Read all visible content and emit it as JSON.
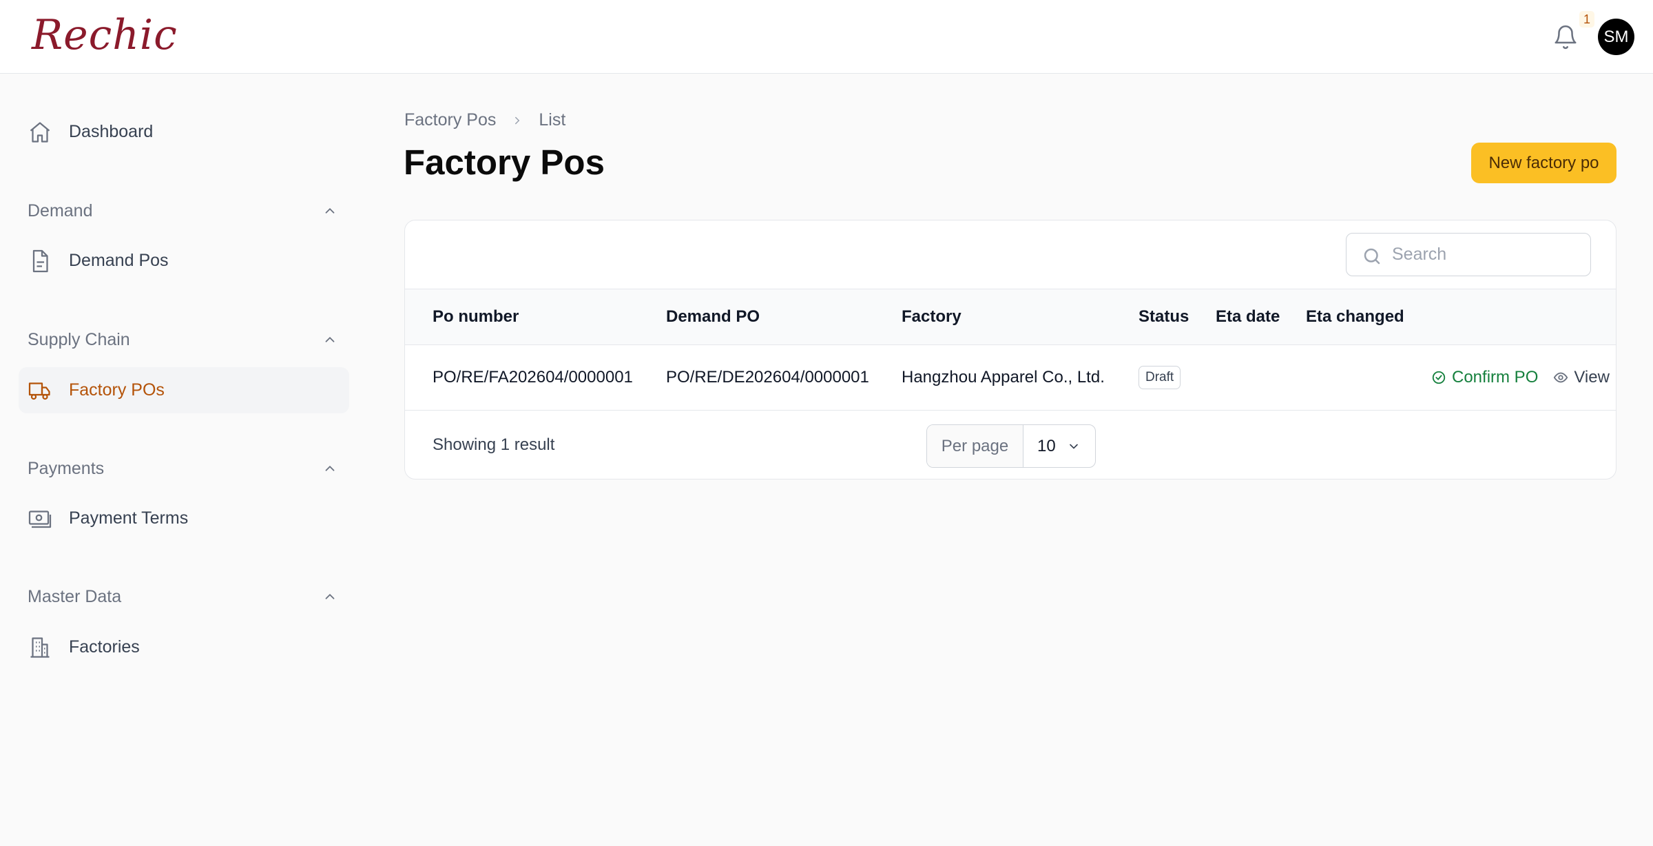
{
  "brand": {
    "logo_text": "Rechic",
    "color": "#8b1a2b"
  },
  "header": {
    "notification_count": "1",
    "user_initials": "SM"
  },
  "sidebar": {
    "dashboard": "Dashboard",
    "groups": [
      {
        "title": "Demand",
        "items": [
          "Demand Pos"
        ]
      },
      {
        "title": "Supply Chain",
        "items": [
          "Factory POs"
        ]
      },
      {
        "title": "Payments",
        "items": [
          "Payment Terms"
        ]
      },
      {
        "title": "Master Data",
        "items": [
          "Factories"
        ]
      }
    ],
    "active_item": "Factory POs"
  },
  "breadcrumb": {
    "parent": "Factory Pos",
    "current": "List"
  },
  "page": {
    "title": "Factory Pos",
    "new_button": "New factory po"
  },
  "search": {
    "placeholder": "Search"
  },
  "table": {
    "columns": [
      "Po number",
      "Demand PO",
      "Factory",
      "Status",
      "Eta date",
      "Eta changed"
    ],
    "rows": [
      {
        "po_number": "PO/RE/FA202604/0000001",
        "demand_po": "PO/RE/DE202604/0000001",
        "factory": "Hangzhou Apparel Co., Ltd.",
        "status": "Draft",
        "eta_date": "",
        "eta_changed": "",
        "actions": [
          "Confirm PO",
          "View"
        ]
      }
    ]
  },
  "pagination": {
    "summary": "Showing 1 result",
    "per_page_label": "Per page",
    "per_page_value": "10"
  },
  "colors": {
    "accent": "#fbbf24",
    "active_nav": "#b45309",
    "confirm": "#15803d"
  }
}
